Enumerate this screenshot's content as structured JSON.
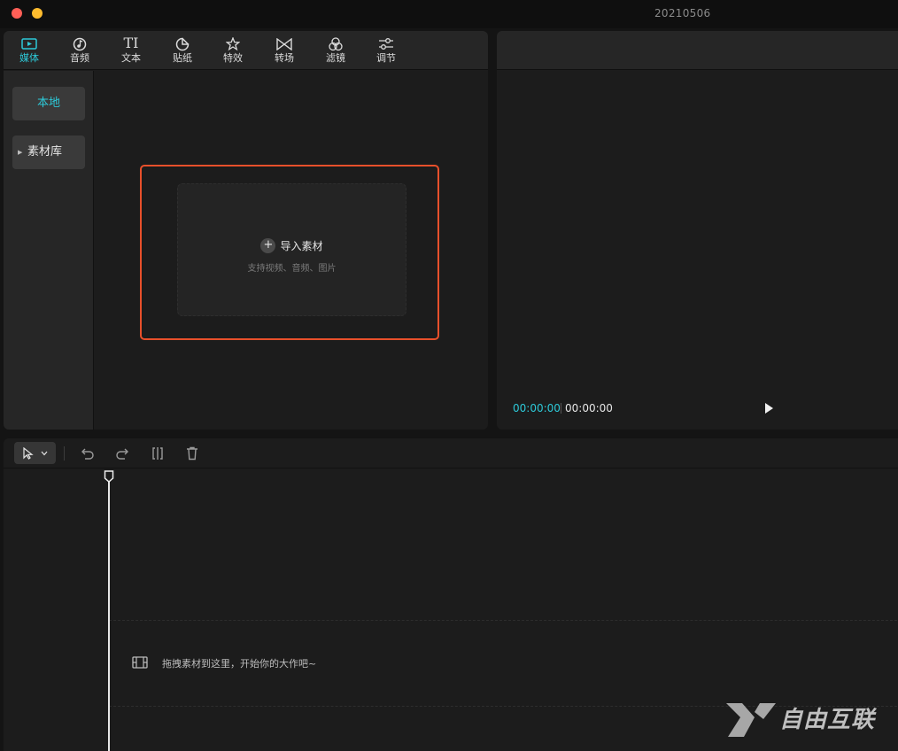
{
  "window": {
    "title": "20210506"
  },
  "toolbar": {
    "tabs": [
      {
        "label": "媒体",
        "icon": "media-icon",
        "active": true
      },
      {
        "label": "音频",
        "icon": "audio-icon"
      },
      {
        "label": "文本",
        "icon": "text-icon",
        "glyph": "TI"
      },
      {
        "label": "贴纸",
        "icon": "sticker-icon"
      },
      {
        "label": "特效",
        "icon": "effects-icon"
      },
      {
        "label": "转场",
        "icon": "transition-icon"
      },
      {
        "label": "滤镜",
        "icon": "filter-icon"
      },
      {
        "label": "调节",
        "icon": "adjust-icon"
      }
    ]
  },
  "sidebar": {
    "local_label": "本地",
    "library_label": "素材库",
    "library_caret": "▶"
  },
  "import": {
    "plus": "+",
    "label": "导入素材",
    "sublabel": "支持视频、音频、图片"
  },
  "preview": {
    "current_time": "00:00:00",
    "total_time": "00:00:00"
  },
  "timeline": {
    "hint": "拖拽素材到这里，开始你的大作吧~",
    "tools": [
      "select-icon",
      "undo-icon",
      "redo-icon",
      "split-icon",
      "delete-icon"
    ]
  },
  "watermark": {
    "text": "自由互联"
  },
  "colors": {
    "accent": "#2dc9d8",
    "highlight": "#e8502b",
    "background": "#141414",
    "panel": "#1c1c1c"
  }
}
